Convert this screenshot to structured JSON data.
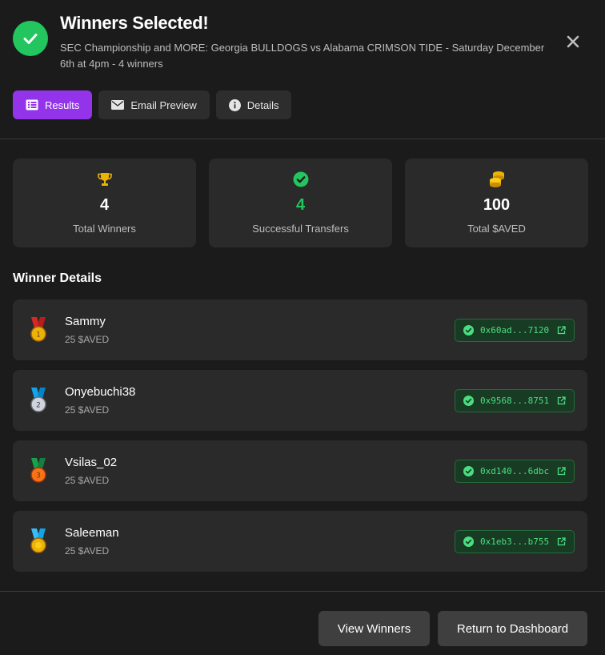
{
  "header": {
    "title": "Winners Selected!",
    "subtitle": "SEC Championship and MORE: Georgia BULLDOGS vs Alabama CRIMSON TIDE - Saturday December 6th at 4pm - 4 winners"
  },
  "tabs": [
    {
      "label": "Results",
      "icon": "list-icon",
      "active": true
    },
    {
      "label": "Email Preview",
      "icon": "envelope-icon",
      "active": false
    },
    {
      "label": "Details",
      "icon": "info-icon",
      "active": false
    }
  ],
  "stats": [
    {
      "value": "4",
      "label": "Total Winners",
      "icon": "trophy-icon",
      "color": "#eab308"
    },
    {
      "value": "4",
      "label": "Successful Transfers",
      "icon": "check-circle-icon",
      "color": "#22c55e"
    },
    {
      "value": "100",
      "label": "Total $AVED",
      "icon": "coins-icon",
      "color": "#eab308"
    }
  ],
  "section_title": "Winner Details",
  "winners": [
    {
      "name": "Sammy",
      "amount": "25 $AVED",
      "tx": "0x60ad...7120",
      "rank": "1",
      "ribbon": "#dc2626",
      "medal": "#eab308"
    },
    {
      "name": "Onyebuchi38",
      "amount": "25 $AVED",
      "tx": "0x9568...8751",
      "rank": "2",
      "ribbon": "#0ea5e9",
      "medal": "#d1d5db"
    },
    {
      "name": "Vsilas_02",
      "amount": "25 $AVED",
      "tx": "0xd140...6dbc",
      "rank": "3",
      "ribbon": "#16a34a",
      "medal": "#f97316"
    },
    {
      "name": "Saleeman",
      "amount": "25 $AVED",
      "tx": "0x1eb3...b755",
      "rank": "",
      "ribbon": "#38bdf8",
      "medal": "#eab308"
    }
  ],
  "footer": {
    "view_winners": "View Winners",
    "return_dashboard": "Return to Dashboard"
  },
  "colors": {
    "accent": "#9333ea",
    "success": "#22c55e",
    "background": "#1b1b1b",
    "card": "#2a2a2a"
  }
}
